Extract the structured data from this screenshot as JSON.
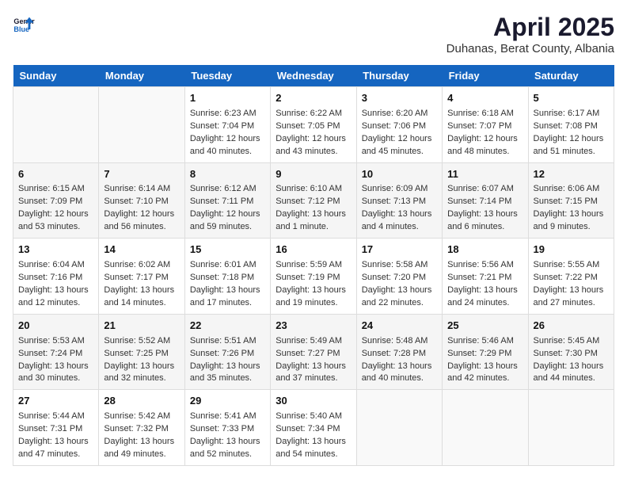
{
  "header": {
    "logo_general": "General",
    "logo_blue": "Blue",
    "month": "April 2025",
    "location": "Duhanas, Berat County, Albania"
  },
  "days_of_week": [
    "Sunday",
    "Monday",
    "Tuesday",
    "Wednesday",
    "Thursday",
    "Friday",
    "Saturday"
  ],
  "weeks": [
    [
      {
        "day": "",
        "info": ""
      },
      {
        "day": "",
        "info": ""
      },
      {
        "day": "1",
        "info": "Sunrise: 6:23 AM\nSunset: 7:04 PM\nDaylight: 12 hours and 40 minutes."
      },
      {
        "day": "2",
        "info": "Sunrise: 6:22 AM\nSunset: 7:05 PM\nDaylight: 12 hours and 43 minutes."
      },
      {
        "day": "3",
        "info": "Sunrise: 6:20 AM\nSunset: 7:06 PM\nDaylight: 12 hours and 45 minutes."
      },
      {
        "day": "4",
        "info": "Sunrise: 6:18 AM\nSunset: 7:07 PM\nDaylight: 12 hours and 48 minutes."
      },
      {
        "day": "5",
        "info": "Sunrise: 6:17 AM\nSunset: 7:08 PM\nDaylight: 12 hours and 51 minutes."
      }
    ],
    [
      {
        "day": "6",
        "info": "Sunrise: 6:15 AM\nSunset: 7:09 PM\nDaylight: 12 hours and 53 minutes."
      },
      {
        "day": "7",
        "info": "Sunrise: 6:14 AM\nSunset: 7:10 PM\nDaylight: 12 hours and 56 minutes."
      },
      {
        "day": "8",
        "info": "Sunrise: 6:12 AM\nSunset: 7:11 PM\nDaylight: 12 hours and 59 minutes."
      },
      {
        "day": "9",
        "info": "Sunrise: 6:10 AM\nSunset: 7:12 PM\nDaylight: 13 hours and 1 minute."
      },
      {
        "day": "10",
        "info": "Sunrise: 6:09 AM\nSunset: 7:13 PM\nDaylight: 13 hours and 4 minutes."
      },
      {
        "day": "11",
        "info": "Sunrise: 6:07 AM\nSunset: 7:14 PM\nDaylight: 13 hours and 6 minutes."
      },
      {
        "day": "12",
        "info": "Sunrise: 6:06 AM\nSunset: 7:15 PM\nDaylight: 13 hours and 9 minutes."
      }
    ],
    [
      {
        "day": "13",
        "info": "Sunrise: 6:04 AM\nSunset: 7:16 PM\nDaylight: 13 hours and 12 minutes."
      },
      {
        "day": "14",
        "info": "Sunrise: 6:02 AM\nSunset: 7:17 PM\nDaylight: 13 hours and 14 minutes."
      },
      {
        "day": "15",
        "info": "Sunrise: 6:01 AM\nSunset: 7:18 PM\nDaylight: 13 hours and 17 minutes."
      },
      {
        "day": "16",
        "info": "Sunrise: 5:59 AM\nSunset: 7:19 PM\nDaylight: 13 hours and 19 minutes."
      },
      {
        "day": "17",
        "info": "Sunrise: 5:58 AM\nSunset: 7:20 PM\nDaylight: 13 hours and 22 minutes."
      },
      {
        "day": "18",
        "info": "Sunrise: 5:56 AM\nSunset: 7:21 PM\nDaylight: 13 hours and 24 minutes."
      },
      {
        "day": "19",
        "info": "Sunrise: 5:55 AM\nSunset: 7:22 PM\nDaylight: 13 hours and 27 minutes."
      }
    ],
    [
      {
        "day": "20",
        "info": "Sunrise: 5:53 AM\nSunset: 7:24 PM\nDaylight: 13 hours and 30 minutes."
      },
      {
        "day": "21",
        "info": "Sunrise: 5:52 AM\nSunset: 7:25 PM\nDaylight: 13 hours and 32 minutes."
      },
      {
        "day": "22",
        "info": "Sunrise: 5:51 AM\nSunset: 7:26 PM\nDaylight: 13 hours and 35 minutes."
      },
      {
        "day": "23",
        "info": "Sunrise: 5:49 AM\nSunset: 7:27 PM\nDaylight: 13 hours and 37 minutes."
      },
      {
        "day": "24",
        "info": "Sunrise: 5:48 AM\nSunset: 7:28 PM\nDaylight: 13 hours and 40 minutes."
      },
      {
        "day": "25",
        "info": "Sunrise: 5:46 AM\nSunset: 7:29 PM\nDaylight: 13 hours and 42 minutes."
      },
      {
        "day": "26",
        "info": "Sunrise: 5:45 AM\nSunset: 7:30 PM\nDaylight: 13 hours and 44 minutes."
      }
    ],
    [
      {
        "day": "27",
        "info": "Sunrise: 5:44 AM\nSunset: 7:31 PM\nDaylight: 13 hours and 47 minutes."
      },
      {
        "day": "28",
        "info": "Sunrise: 5:42 AM\nSunset: 7:32 PM\nDaylight: 13 hours and 49 minutes."
      },
      {
        "day": "29",
        "info": "Sunrise: 5:41 AM\nSunset: 7:33 PM\nDaylight: 13 hours and 52 minutes."
      },
      {
        "day": "30",
        "info": "Sunrise: 5:40 AM\nSunset: 7:34 PM\nDaylight: 13 hours and 54 minutes."
      },
      {
        "day": "",
        "info": ""
      },
      {
        "day": "",
        "info": ""
      },
      {
        "day": "",
        "info": ""
      }
    ]
  ]
}
